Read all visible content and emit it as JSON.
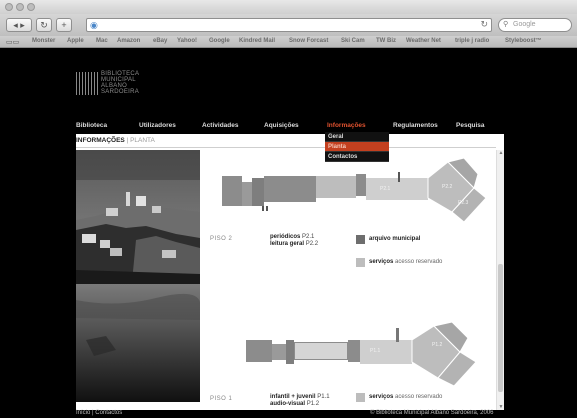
{
  "browser": {
    "url": "",
    "search_placeholder": "Google",
    "bookmarks": [
      "Monster",
      "Apple",
      "Mac",
      "Amazon",
      "eBay",
      "Yahoo!",
      "Google",
      "Kindred Mail",
      "Snow Forcast",
      "Ski Cam",
      "TW Biz",
      "Weather Net",
      "triple j radio",
      "Styleboost™"
    ]
  },
  "site": {
    "logo": [
      "BIBLIOTECA",
      "MUNICIPAL",
      "ALBANO",
      "SARDOEIRA"
    ],
    "nav": [
      "Biblioteca",
      "Utilizadores",
      "Actividades",
      "Aquisições",
      "Informações",
      "Regulamentos",
      "Pesquisa"
    ],
    "nav_active": "Informações",
    "dropdown": [
      "Geral",
      "Planta",
      "Contactos"
    ],
    "dropdown_selected": "Planta",
    "breadcrumb": {
      "section": "INFORMAÇÕES",
      "page": "PLANTA"
    }
  },
  "floors": [
    {
      "label": "PISO 2",
      "info_lines": [
        {
          "name": "periódicos",
          "code": "P2.1"
        },
        {
          "name": "leitura geral",
          "code": "P2.2"
        }
      ],
      "legend": [
        {
          "name": "arquivo municipal",
          "note": "",
          "color": "#6e6e6e"
        },
        {
          "name": "serviços",
          "note": "acesso reservado",
          "color": "#bdbdbd"
        }
      ],
      "room_labels": [
        "P2.1",
        "P2.2",
        "P2.3"
      ]
    },
    {
      "label": "PISO 1",
      "info_lines": [
        {
          "name": "infantil + juvenil",
          "code": "P1.1"
        },
        {
          "name": "audio-visual",
          "code": "P1.2"
        }
      ],
      "legend": [
        {
          "name": "serviços",
          "note": "acesso reservado",
          "color": "#bdbdbd"
        }
      ],
      "room_labels": [
        "P1.1",
        "P1.2"
      ]
    }
  ],
  "footer": {
    "left": "Início | Contactos",
    "right": "© Biblioteca Municipal Albano Sardoeira, 2006"
  },
  "colors": {
    "active_nav": "#e0522f",
    "dropdown_selected_bg": "#c4401f",
    "plan_dark": "#8c8c8c",
    "plan_light": "#bdbdbd"
  }
}
